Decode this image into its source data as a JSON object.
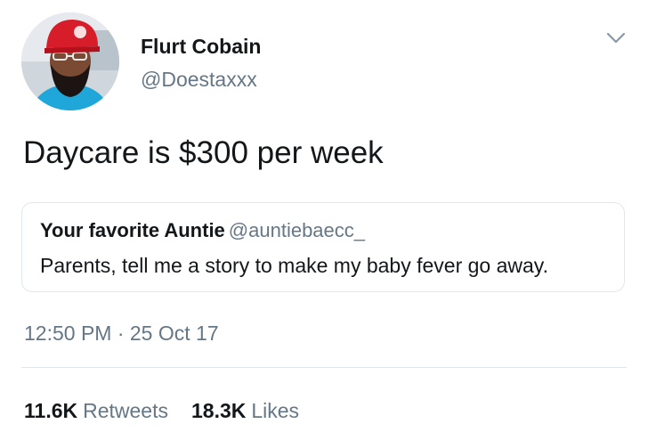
{
  "author": {
    "display_name": "Flurt Cobain",
    "handle": "@Doestaxxx",
    "avatar_icon": "profile-photo"
  },
  "tweet": {
    "text": "Daycare is $300 per week",
    "timestamp": "12:50 PM · 25 Oct 17"
  },
  "quoted_tweet": {
    "display_name": "Your favorite Auntie",
    "handle": "@auntiebaecc_",
    "text": "Parents, tell me a story to make my baby fever go away."
  },
  "stats": {
    "retweets_count": "11.6K",
    "retweets_label": "Retweets",
    "likes_count": "18.3K",
    "likes_label": "Likes"
  },
  "colors": {
    "text_primary": "#14171a",
    "text_secondary": "#657786",
    "border": "#e1e8ed",
    "background": "#ffffff"
  }
}
